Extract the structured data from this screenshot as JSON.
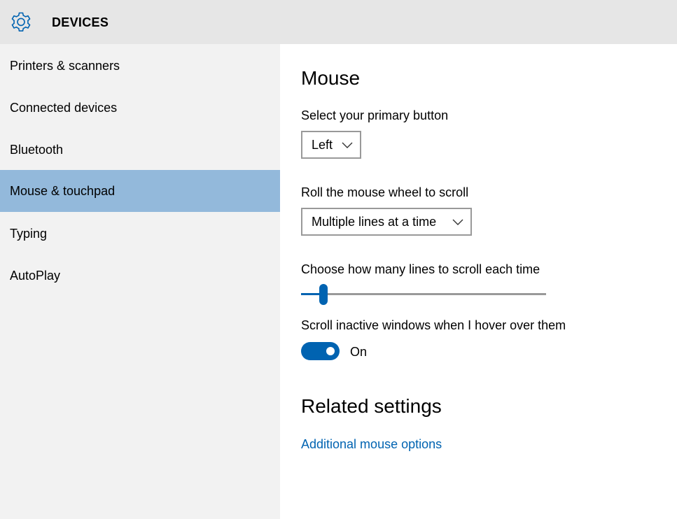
{
  "header": {
    "title": "DEVICES",
    "icon": "gear-icon"
  },
  "sidebar": {
    "items": [
      {
        "label": "Printers & scanners",
        "active": false
      },
      {
        "label": "Connected devices",
        "active": false
      },
      {
        "label": "Bluetooth",
        "active": false
      },
      {
        "label": "Mouse & touchpad",
        "active": true
      },
      {
        "label": "Typing",
        "active": false
      },
      {
        "label": "AutoPlay",
        "active": false
      }
    ]
  },
  "main": {
    "title": "Mouse",
    "primary_button": {
      "label": "Select your primary button",
      "value": "Left"
    },
    "wheel_scroll": {
      "label": "Roll the mouse wheel to scroll",
      "value": "Multiple lines at a time"
    },
    "lines_scroll": {
      "label": "Choose how many lines to scroll each time",
      "level": 0.09
    },
    "inactive_scroll": {
      "label": "Scroll inactive windows when I hover over them",
      "state": "On"
    },
    "related": {
      "title": "Related settings",
      "link": "Additional mouse options"
    }
  },
  "colors": {
    "accent": "#0063b1",
    "selected_nav": "#93b9db",
    "header_bg": "#e6e6e6",
    "sidebar_bg": "#f2f2f2"
  }
}
